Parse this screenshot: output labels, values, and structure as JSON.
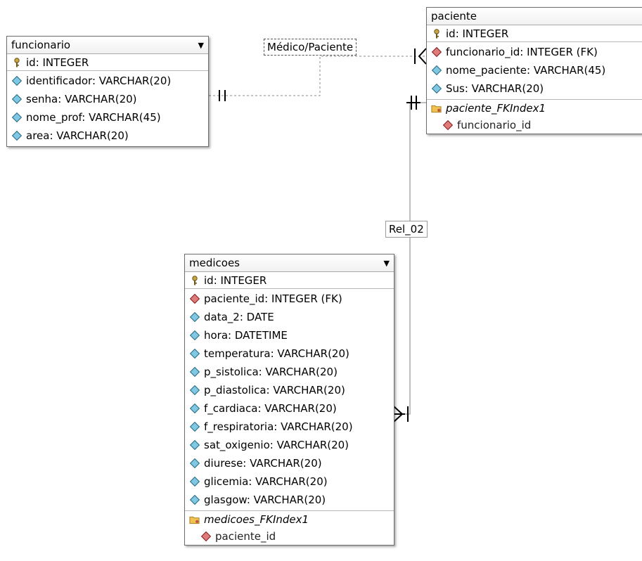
{
  "tables": {
    "funcionario": {
      "name": "funcionario",
      "pk": "id: INTEGER",
      "fields": [
        "identificador: VARCHAR(20)",
        "senha: VARCHAR(20)",
        "nome_prof: VARCHAR(45)",
        "area: VARCHAR(20)"
      ]
    },
    "paciente": {
      "name": "paciente",
      "pk": "id: INTEGER",
      "fields": [
        {
          "text": "funcionario_id: INTEGER (FK)",
          "fk": true
        },
        {
          "text": "nome_paciente: VARCHAR(45)",
          "fk": false
        },
        {
          "text": "Sus: VARCHAR(20)",
          "fk": false
        }
      ],
      "index_name": "paciente_FKIndex1",
      "index_field": "funcionario_id"
    },
    "medicoes": {
      "name": "medicoes",
      "pk": "id: INTEGER",
      "fields": [
        {
          "text": "paciente_id: INTEGER (FK)",
          "fk": true
        },
        {
          "text": "data_2: DATE",
          "fk": false
        },
        {
          "text": "hora: DATETIME",
          "fk": false
        },
        {
          "text": "temperatura: VARCHAR(20)",
          "fk": false
        },
        {
          "text": "p_sistolica: VARCHAR(20)",
          "fk": false
        },
        {
          "text": "p_diastolica: VARCHAR(20)",
          "fk": false
        },
        {
          "text": "f_cardiaca: VARCHAR(20)",
          "fk": false
        },
        {
          "text": "f_respiratoria: VARCHAR(20)",
          "fk": false
        },
        {
          "text": "sat_oxigenio: VARCHAR(20)",
          "fk": false
        },
        {
          "text": "diurese: VARCHAR(20)",
          "fk": false
        },
        {
          "text": "glicemia: VARCHAR(20)",
          "fk": false
        },
        {
          "text": "glasgow: VARCHAR(20)",
          "fk": false
        }
      ],
      "index_name": "medicoes_FKIndex1",
      "index_field": "paciente_id"
    }
  },
  "relations": {
    "medico_paciente": "Médico/Paciente",
    "rel_02": "Rel_02"
  },
  "colors": {
    "attribute_diamond": "#7ec8e3",
    "fk_diamond": "#e07b7b",
    "key_icon": "#c8a445",
    "index_folder": "#f0c24e"
  },
  "icons": {
    "primary_key": "key-icon",
    "attribute": "diamond-icon",
    "foreign_key": "fk-diamond-icon",
    "index": "index-folder-icon",
    "collapse": "dropdown-arrow-icon"
  }
}
